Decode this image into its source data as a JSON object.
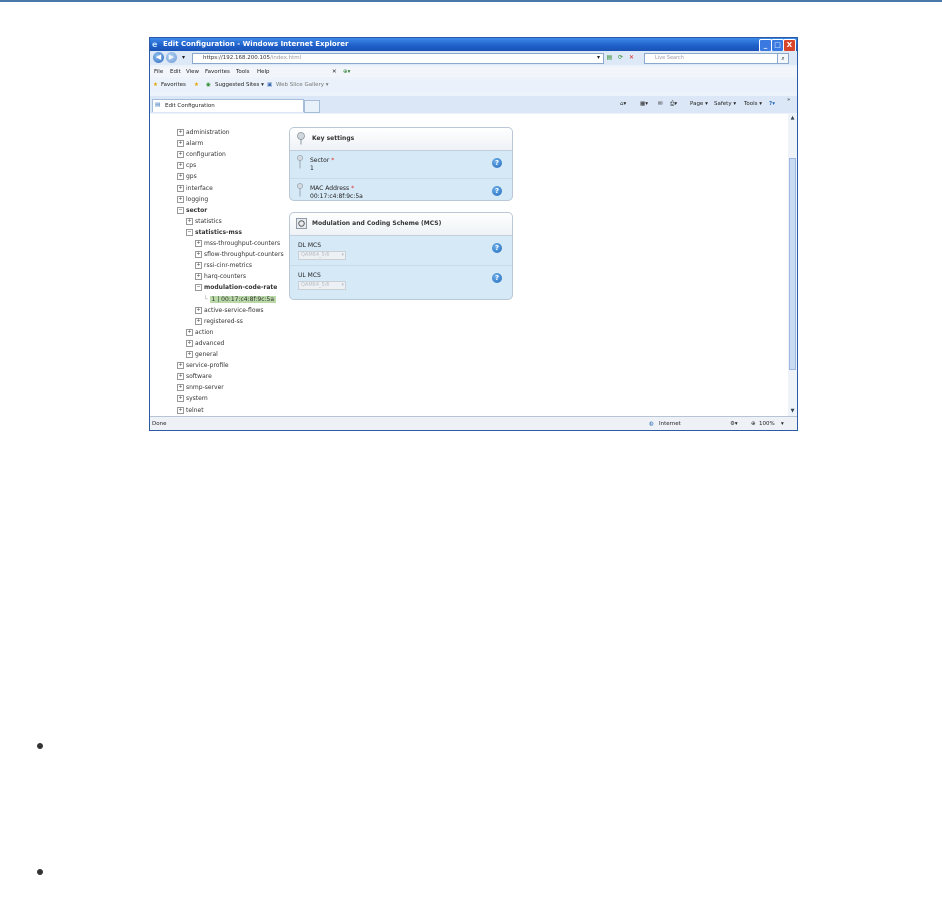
{
  "window": {
    "title": "Edit Configuration - Windows Internet Explorer",
    "buttons": {
      "minimize": "_",
      "maximize": "□",
      "close": "X"
    }
  },
  "address_bar": {
    "url_host": "https://192.168.200.105",
    "url_path": "/index.html",
    "search_placeholder": "Live Search"
  },
  "menu": [
    "File",
    "Edit",
    "View",
    "Favorites",
    "Tools",
    "Help"
  ],
  "favorites_bar": {
    "favorites": "Favorites",
    "suggested_sites": "Suggested Sites ▾",
    "web_slice_gallery": "Web Slice Gallery ▾"
  },
  "tab": {
    "label": "Edit Configuration"
  },
  "command_bar": {
    "page": "Page ▾",
    "safety": "Safety ▾",
    "tools": "Tools ▾",
    "help": "?▾",
    "more": "»"
  },
  "tree": [
    {
      "label": "administration",
      "sign": "+",
      "level": 0
    },
    {
      "label": "alarm",
      "sign": "+",
      "level": 0
    },
    {
      "label": "configuration",
      "sign": "+",
      "level": 0
    },
    {
      "label": "cps",
      "sign": "+",
      "level": 0
    },
    {
      "label": "gps",
      "sign": "+",
      "level": 0
    },
    {
      "label": "interface",
      "sign": "+",
      "level": 0
    },
    {
      "label": "logging",
      "sign": "+",
      "level": 0
    },
    {
      "label": "sector",
      "sign": "−",
      "level": 0
    },
    {
      "label": "statistics",
      "sign": "+",
      "level": 1
    },
    {
      "label": "statistics-mss",
      "sign": "−",
      "level": 1
    },
    {
      "label": "mss-throughput-counters",
      "sign": "+",
      "level": 2
    },
    {
      "label": "sflow-throughput-counters",
      "sign": "+",
      "level": 2
    },
    {
      "label": "rssi-cinr-metrics",
      "sign": "+",
      "level": 2
    },
    {
      "label": "harq-counters",
      "sign": "+",
      "level": 2
    },
    {
      "label": "modulation-code-rate",
      "sign": "−",
      "level": 2
    },
    {
      "label": "1 | 00:17:c4:8f:9c:5a",
      "sign": "",
      "level": 3
    },
    {
      "label": "active-service-flows",
      "sign": "+",
      "level": 2
    },
    {
      "label": "registered-ss",
      "sign": "+",
      "level": 2
    },
    {
      "label": "action",
      "sign": "+",
      "level": 1
    },
    {
      "label": "advanced",
      "sign": "+",
      "level": 1
    },
    {
      "label": "general",
      "sign": "+",
      "level": 1
    },
    {
      "label": "service-profile",
      "sign": "+",
      "level": 0
    },
    {
      "label": "software",
      "sign": "+",
      "level": 0
    },
    {
      "label": "snmp-server",
      "sign": "+",
      "level": 0
    },
    {
      "label": "system",
      "sign": "+",
      "level": 0
    },
    {
      "label": "telnet",
      "sign": "+",
      "level": 0
    }
  ],
  "key_settings": {
    "title": "Key settings",
    "sector_label": "Sector",
    "sector_value": "1",
    "mac_label": "MAC Address",
    "mac_value": "00:17:c4:8f:9c:5a",
    "required_mark": "*"
  },
  "mcs": {
    "title": "Modulation and Coding Scheme (MCS)",
    "dl_label": "DL MCS",
    "dl_value": "QAM64_5/6",
    "ul_label": "UL MCS",
    "ul_value": "QAM64_5/6"
  },
  "status_bar": {
    "left": "Done",
    "zone": "Internet",
    "zoom": "100%"
  }
}
